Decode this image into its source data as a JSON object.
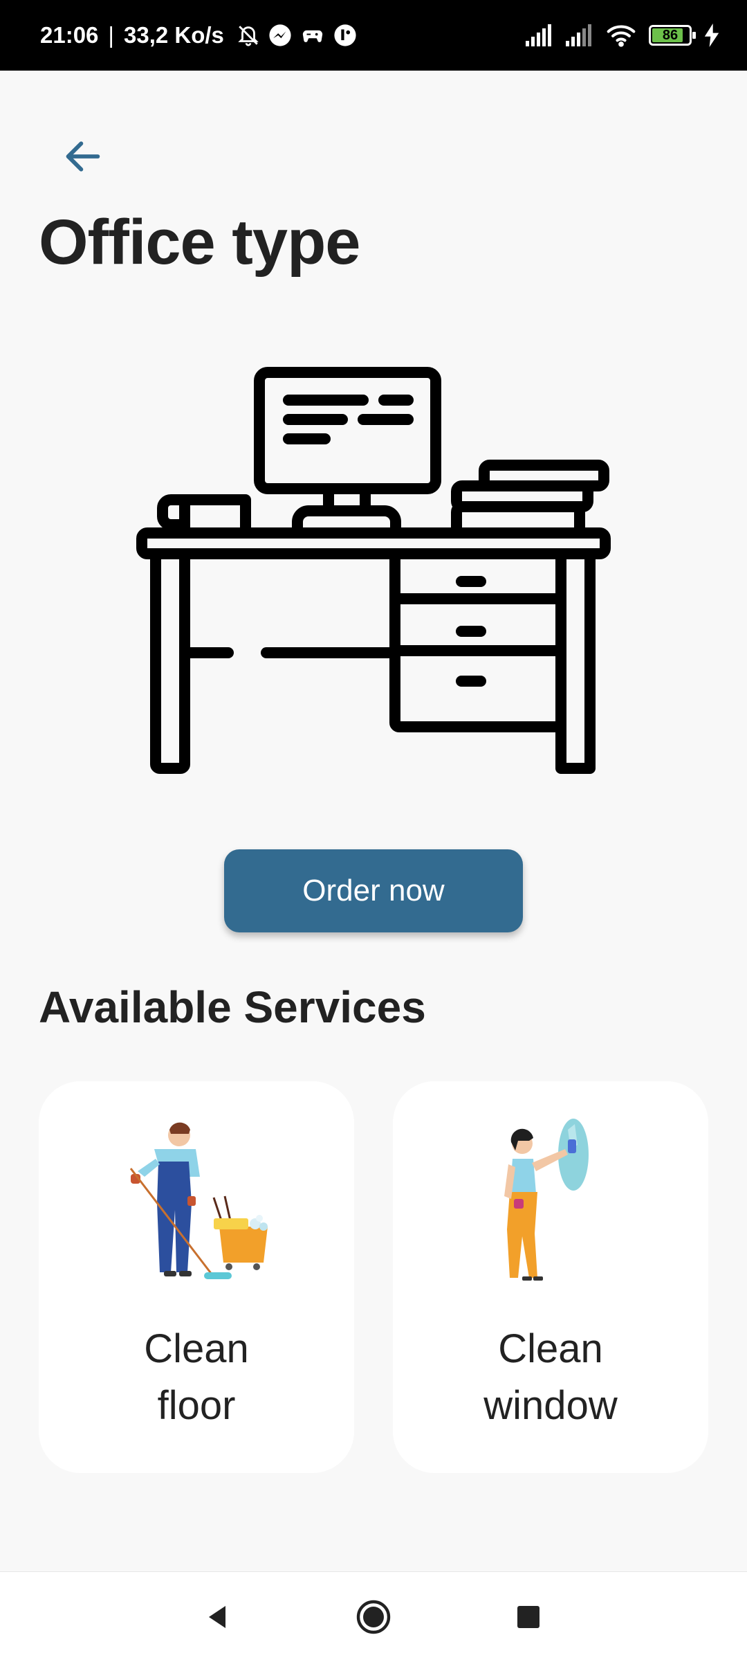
{
  "status_bar": {
    "time": "21:06",
    "separator": "|",
    "network_speed": "33,2 Ko/s",
    "icons": [
      "bell-off-icon",
      "messenger-icon",
      "game-controller-icon",
      "app-icon"
    ],
    "right_icons": [
      "signal-icon",
      "signal-icon",
      "wifi-icon",
      "battery-icon",
      "charging-icon"
    ],
    "battery_level": "86",
    "battery_fraction": 0.86
  },
  "header": {
    "back_icon": "arrow-left-icon",
    "title": "Office type"
  },
  "hero": {
    "icon": "office-desk-icon"
  },
  "order_button": {
    "label": "Order now"
  },
  "services": {
    "title": "Available Services",
    "items": [
      {
        "label": "Clean\nfloor",
        "illustration": "floor-cleaner-illustration"
      },
      {
        "label": "Clean\nwindow",
        "illustration": "window-cleaner-illustration"
      }
    ]
  },
  "nav_bar": {
    "icons": [
      "back-triangle-icon",
      "home-circle-icon",
      "recents-square-icon"
    ]
  },
  "colors": {
    "accent": "#336b90",
    "background": "#f8f8f8",
    "card": "#ffffff",
    "text": "#222222"
  }
}
